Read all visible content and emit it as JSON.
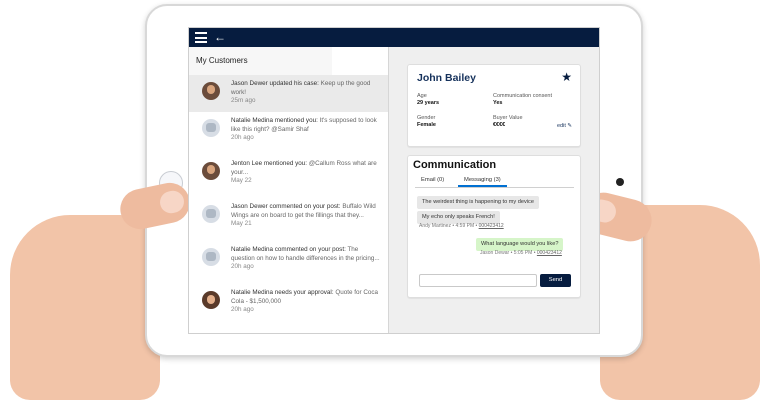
{
  "left_panel": {
    "title": "My Customers",
    "feed": [
      {
        "actor": "Jason Dewer",
        "action": " updated his case: ",
        "body": "Keep up the good work!",
        "time": "25m ago"
      },
      {
        "actor": "Natalie Medina",
        "action": " mentioned you: ",
        "body": "It's supposed to look like this right? @Samir Shaf",
        "time": "20h ago"
      },
      {
        "actor": "Jenton Lee",
        "action": " mentioned you: ",
        "body": "@Callum Ross what are your...",
        "time": "May 22"
      },
      {
        "actor": "Jason Dewer",
        "action": " commented on your post: ",
        "body": "Buffalo Wild Wings are on board to get the fillings that they...",
        "time": "May 21"
      },
      {
        "actor": "Natalie Medina",
        "action": " commented on your post: ",
        "body": "The question on how to handle differences in the pricing...",
        "time": "20h ago"
      },
      {
        "actor": "Natalie Medina",
        "action": " needs your approval: ",
        "body": "Quote for Coca Cola - $1,500,000",
        "time": "20h ago"
      }
    ]
  },
  "contact": {
    "name": "John Bailey",
    "fields": {
      "age_label": "Age",
      "age_value": "29 years",
      "consent_label": "Communication consent",
      "consent_value": "Yes",
      "gender_label": "Gender",
      "gender_value": "Female",
      "buyer_label": "Buyer Value",
      "buyer_value": "€€€€"
    },
    "edit_label": "edit"
  },
  "communication": {
    "title": "Communication",
    "tabs": [
      {
        "label": "Email (0)"
      },
      {
        "label": "Messaging (3)"
      }
    ],
    "messages": [
      {
        "text": "The weirdest thing is happening to my device"
      },
      {
        "text": "My echo only speaks French!",
        "meta_prefix": "Andy Martinez • 4:59 PM • ",
        "meta_id": "000423412"
      },
      {
        "text": "What language would you like?",
        "meta_prefix": "Jason Dewar • 5:05 PM • ",
        "meta_id": "000423412"
      }
    ],
    "send_label": "Send"
  },
  "icons": {
    "menu": "hamburger-icon",
    "back": "back-arrow-icon",
    "favorite": "star-icon",
    "edit": "pencil-icon"
  },
  "colors": {
    "brand_navy": "#061c3f",
    "tab_active": "#0070d2",
    "outgoing_bubble": "#d6f5c9"
  }
}
